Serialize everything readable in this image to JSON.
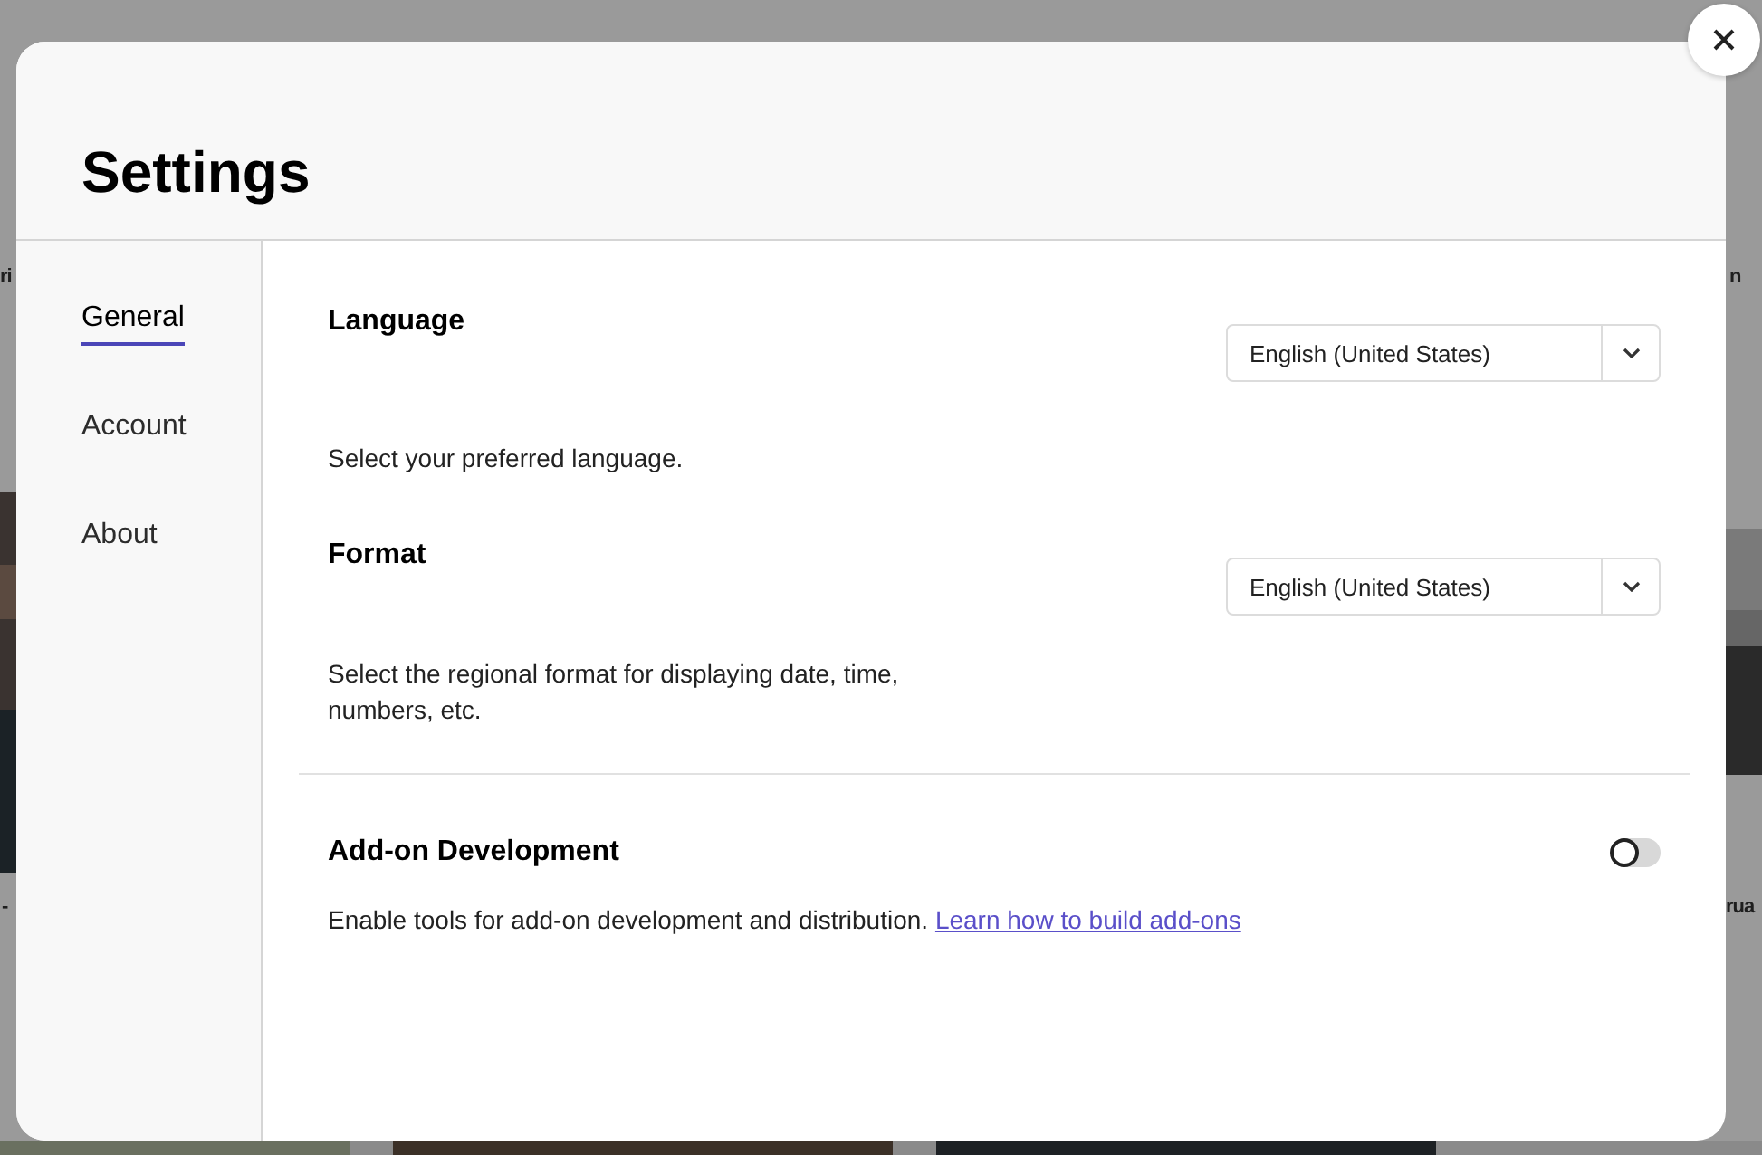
{
  "background": {
    "fragments": [
      {
        "text": "ri"
      },
      {
        "text": "n"
      },
      {
        "text": "-"
      },
      {
        "text": "rua"
      }
    ]
  },
  "dialog": {
    "title": "Settings",
    "sidebar": {
      "items": [
        {
          "label": "General",
          "selected": true
        },
        {
          "label": "Account",
          "selected": false
        },
        {
          "label": "About",
          "selected": false
        }
      ]
    },
    "sections": [
      {
        "kind": "dropdown",
        "heading": "Language",
        "description": "Select your preferred language.",
        "value": "English (United States)"
      },
      {
        "kind": "dropdown",
        "heading": "Format",
        "description": "Select the regional format for displaying date, time, numbers, etc.",
        "value": "English (United States)"
      },
      {
        "kind": "toggle",
        "heading": "Add-on Development",
        "description": "Enable tools for add-on development and distribution.",
        "link": "Learn how to build add-ons",
        "on": false
      }
    ]
  }
}
